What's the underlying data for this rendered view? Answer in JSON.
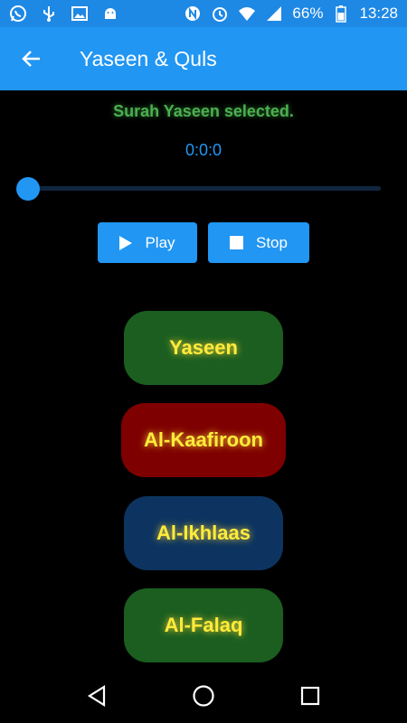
{
  "status_bar": {
    "battery": "66%",
    "time": "13:28",
    "left_icons": [
      "whatsapp-icon",
      "usb-icon",
      "image-icon",
      "android-icon"
    ],
    "right_icons": [
      "nfc-icon",
      "alarm-icon",
      "wifi-icon",
      "signal-icon",
      "battery-icon"
    ]
  },
  "app_bar": {
    "title": "Yaseen & Quls",
    "back_icon": "arrow-left-icon"
  },
  "player": {
    "status_message": "Surah Yaseen selected.",
    "time": "0:0:0",
    "progress": 0,
    "play_label": "Play",
    "stop_label": "Stop"
  },
  "surahs": [
    {
      "label": "Yaseen",
      "color": "#1b5e20"
    },
    {
      "label": "Al-Kaafiroon",
      "color": "#7f0000"
    },
    {
      "label": "Al-Ikhlaas",
      "color": "#0d3460"
    },
    {
      "label": "Al-Falaq",
      "color": "#1b5e20"
    }
  ],
  "colors": {
    "accent": "#2196f3",
    "status_text": "#4caf50",
    "button_text": "#ffeb3b"
  }
}
